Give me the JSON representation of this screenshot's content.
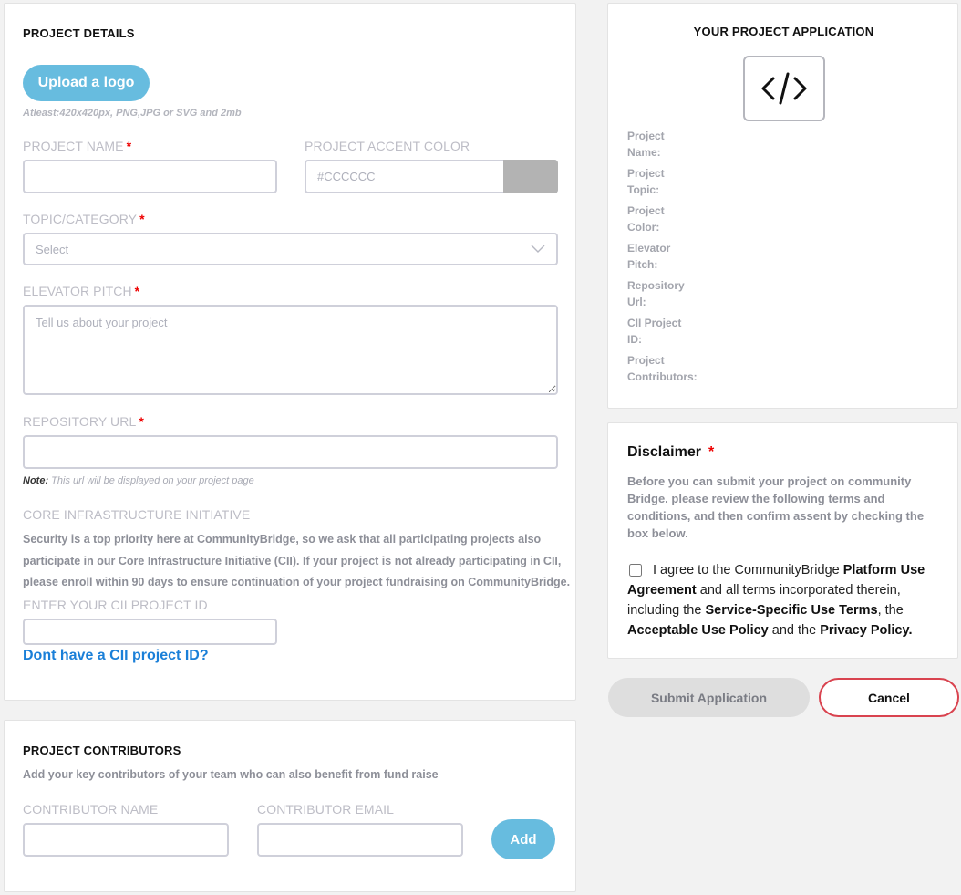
{
  "project_details": {
    "title": "PROJECT DETAILS",
    "upload_button": "Upload a logo",
    "upload_hint": "Atleast:420x420px, PNG,JPG or SVG and 2mb",
    "project_name_label": "PROJECT NAME",
    "project_name_value": "",
    "accent_color_label": "PROJECT ACCENT COLOR",
    "accent_color_placeholder": "#CCCCCC",
    "accent_swatch_color": "#b3b3b3",
    "topic_label": "TOPIC/CATEGORY",
    "topic_selected": "Select",
    "pitch_label": "ELEVATOR PITCH",
    "pitch_placeholder": "Tell us about your project",
    "repo_label": "REPOSITORY URL",
    "repo_value": "",
    "repo_note_prefix": "Note:",
    "repo_note_text": " This url will be displayed on your project page",
    "cii_heading": "CORE INFRASTRUCTURE INITIATIVE",
    "cii_paragraph_1": "Security is a top priority here at CommunityBridge, so we ask that all participating projects also",
    "cii_paragraph_2": "participate in our Core Infrastructure Initiative (CII). If your project is not already participating in CII,",
    "cii_paragraph_3": "please enroll within 90 days to ensure continuation of your project fundraising on CommunityBridge.",
    "cii_id_label": "ENTER YOUR CII PROJECT ID",
    "cii_id_value": "",
    "cii_link": "Dont have a CII project ID?"
  },
  "contributors": {
    "title": "PROJECT CONTRIBUTORS",
    "subtitle": "Add your key contributors of your team who can also benefit from fund raise",
    "name_label": "CONTRIBUTOR NAME",
    "email_label": "CONTRIBUTOR EMAIL",
    "add_button": "Add"
  },
  "application": {
    "title": "YOUR PROJECT APPLICATION",
    "code_icon": "code-icon",
    "fields": [
      {
        "line1": "Project",
        "line2": "Name:"
      },
      {
        "line1": "Project",
        "line2": "Topic:"
      },
      {
        "line1": "Project",
        "line2": "Color:"
      },
      {
        "line1": "Elevator",
        "line2": "Pitch:"
      },
      {
        "line1": "Repository",
        "line2": "Url:"
      },
      {
        "line1": "CII Project",
        "line2": "ID:"
      },
      {
        "line1": "Project",
        "line2": "Contributors:"
      }
    ]
  },
  "disclaimer": {
    "title": "Disclaimer",
    "line1": "Before you can submit your project on community",
    "line2": "Bridge. please review the following terms and",
    "line3": "conditions, and then confirm assent by checking the",
    "line4": "box below.",
    "agree_1": "I agree to the CommunityBridge ",
    "agree_link_1a": "Platform Use",
    "agree_link_1b": "Agreement",
    "agree_2": " and all terms incorporated therein,",
    "agree_3": "including the ",
    "agree_link_2": "Service-Specific Use Terms",
    "agree_4": ", the",
    "agree_link_3": "Acceptable Use Policy",
    "agree_5": " and the ",
    "agree_link_4": "Privacy Policy."
  },
  "actions": {
    "submit": "Submit Application",
    "cancel": "Cancel"
  },
  "colors": {
    "accent_blue": "#67bcdf",
    "link_blue": "#1a7fd8",
    "cancel_border": "#d9434f",
    "required": "#e00000"
  }
}
